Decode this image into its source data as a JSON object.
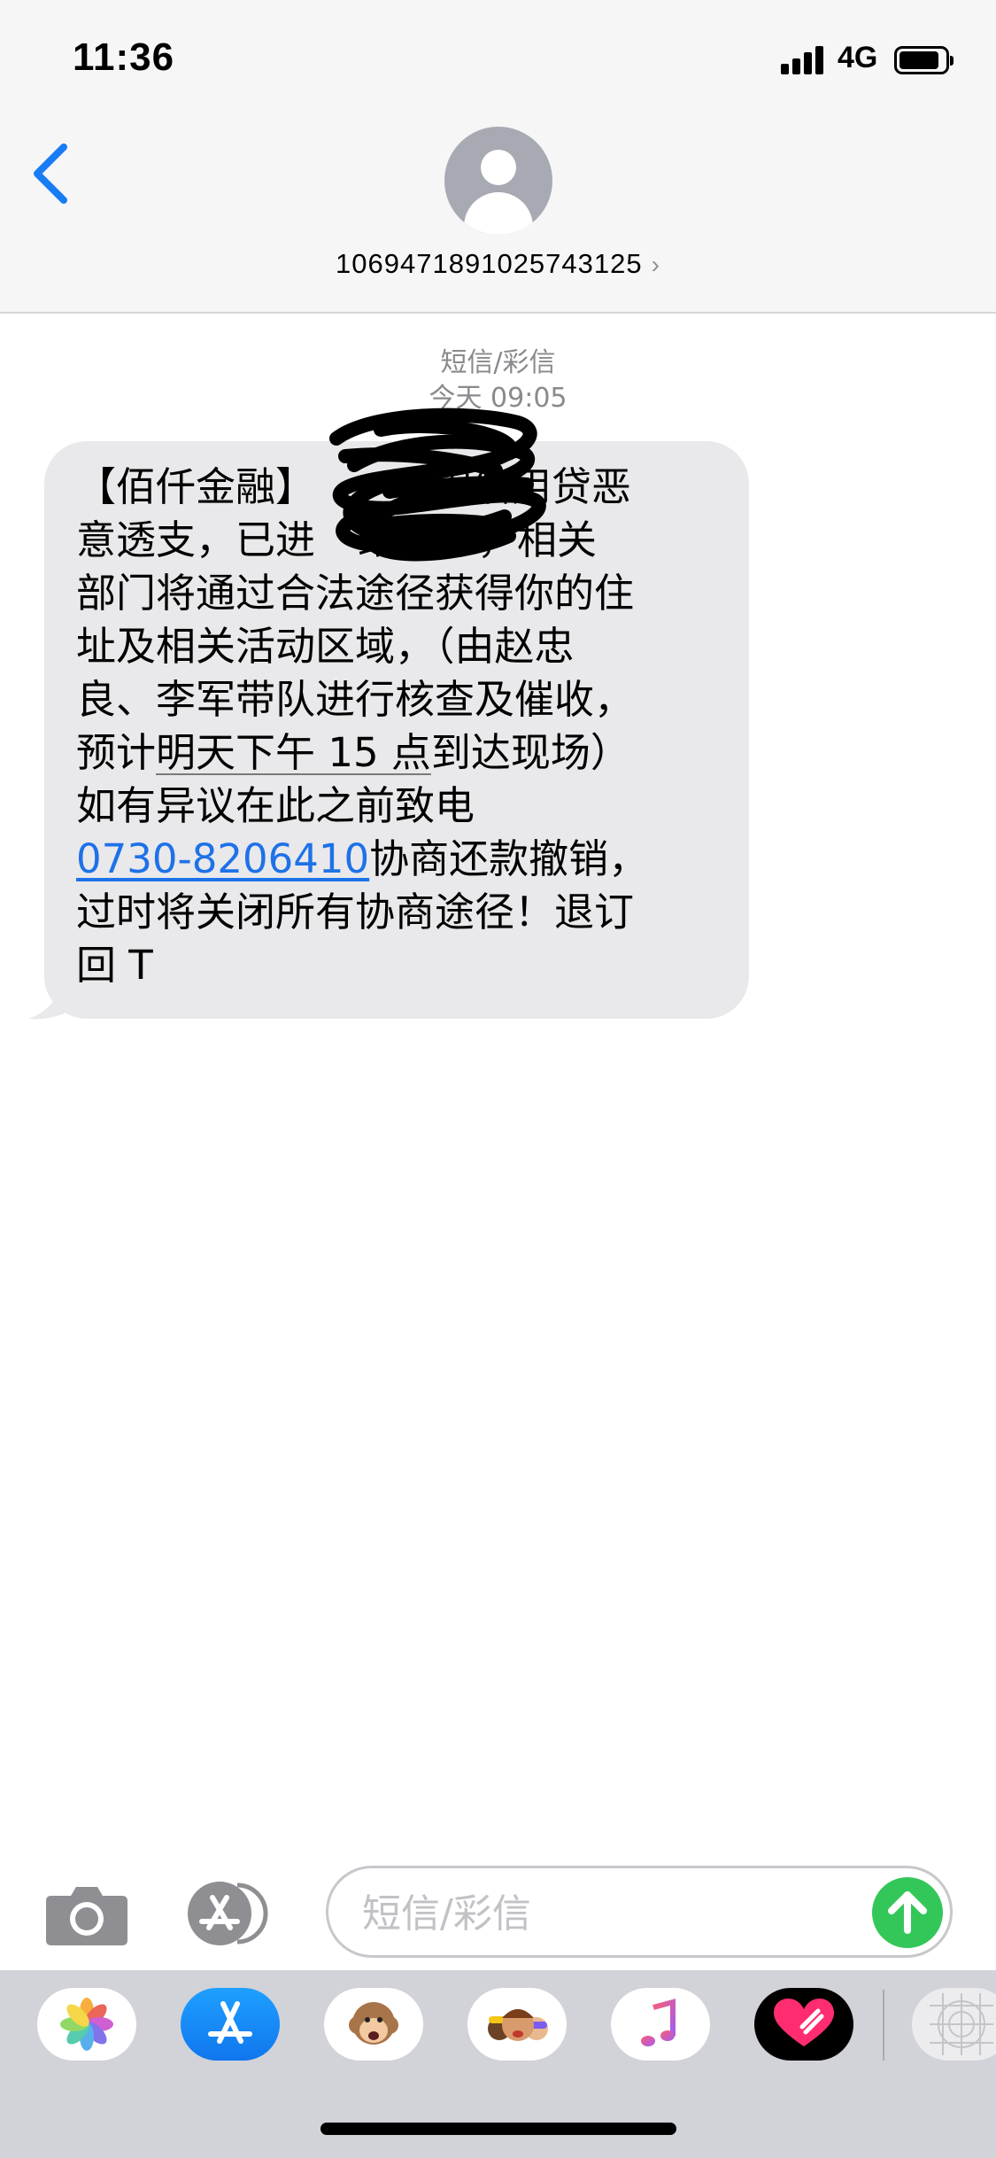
{
  "status_bar": {
    "time": "11:36",
    "network": "4G"
  },
  "header": {
    "contact_number": "1069471891025743125",
    "icons": [
      "back-chevron-icon",
      "contact-avatar-icon",
      "chevron-right-icon"
    ]
  },
  "thread": {
    "service_label": "短信/彩信",
    "timestamp": "今天 09:05",
    "message": {
      "line1": "【佰仟金融】",
      "line1_rest": "因信用贷恶",
      "line2_start": "意透支，已进",
      "line2_end": "络公示，相关",
      "line3": "部门将通过合法途径获得你的住",
      "line4": "址及相关活动区域，（由赵忠",
      "line5": "良、李军带队进行核查及催收，",
      "line6_pre": "预计",
      "line6_underlined": "明天下午 15 点",
      "line6_post": "到达现场）",
      "line7": "如有异议在此之前致电",
      "phone": "0730-8206410",
      "line8_post": "协商还款撤销，",
      "line9": "过时将关闭所有协商途径！退订",
      "line10": "回 T"
    },
    "redaction": "handwritten-scribble-over-text"
  },
  "compose": {
    "placeholder": "短信/彩信",
    "value": ""
  },
  "app_drawer": {
    "apps": [
      "photos-icon",
      "app-store-icon",
      "animoji-icon",
      "memoji-icon",
      "music-icon",
      "digital-touch-icon",
      "more-apps-icon"
    ]
  },
  "colors": {
    "accent": "#1e72e8",
    "send": "#33c759",
    "bubble": "#e9e9eb",
    "header_bg": "#f6f6f7",
    "drawer_bg": "#d1d3d9"
  }
}
